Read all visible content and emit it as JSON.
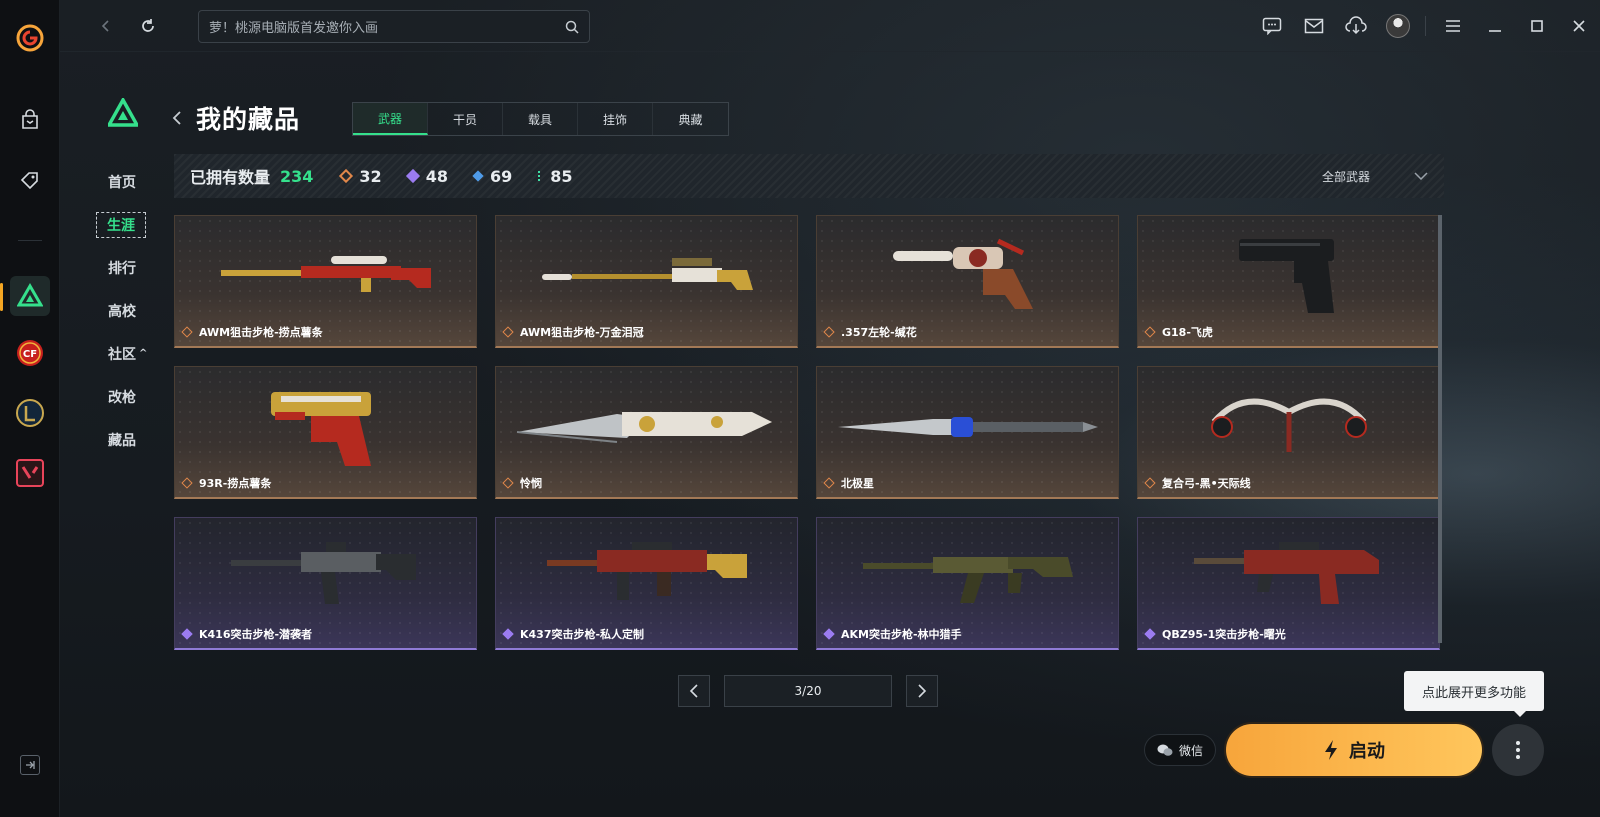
{
  "topbar": {
    "search_placeholder": "萝！桃源电脑版首发邀你入画"
  },
  "subnav": {
    "items": [
      {
        "label": "首页"
      },
      {
        "label": "生涯"
      },
      {
        "label": "排行"
      },
      {
        "label": "高校"
      },
      {
        "label": "社区"
      },
      {
        "label": "改枪"
      },
      {
        "label": "藏品"
      }
    ],
    "community_chevron": "^"
  },
  "page": {
    "title": "我的藏品",
    "tabs": [
      "武器",
      "干员",
      "载具",
      "挂饰",
      "典藏"
    ],
    "active_tab": "武器"
  },
  "stats": {
    "owned_label": "已拥有数量",
    "owned_value": "234",
    "tiers": [
      {
        "value": "32",
        "color": "#e0874a"
      },
      {
        "value": "48",
        "color": "#9b7cf0"
      },
      {
        "value": "69",
        "color": "#4f9be8"
      },
      {
        "value": "85",
        "color": "#3fe0a6"
      }
    ],
    "filter_label": "全部武器"
  },
  "items": [
    {
      "name": "AWM狙击步枪-捞点薯条",
      "rarity": "orange"
    },
    {
      "name": "AWM狙击步枪-万金泪冠",
      "rarity": "orange"
    },
    {
      "name": ".357左轮-缄花",
      "rarity": "orange"
    },
    {
      "name": "G18-飞虎",
      "rarity": "orange"
    },
    {
      "name": "93R-捞点薯条",
      "rarity": "orange"
    },
    {
      "name": "怜悯",
      "rarity": "orange"
    },
    {
      "name": "北极星",
      "rarity": "orange"
    },
    {
      "name": "复合弓-黑•天际线",
      "rarity": "orange"
    },
    {
      "name": "K416突击步枪-潜袭者",
      "rarity": "purple"
    },
    {
      "name": "K437突击步枪-私人定制",
      "rarity": "purple"
    },
    {
      "name": "AKM突击步枪-林中猎手",
      "rarity": "purple"
    },
    {
      "name": "QBZ95-1突击步枪-曙光",
      "rarity": "purple"
    }
  ],
  "pager": {
    "value": "3/20"
  },
  "actions": {
    "tooltip": "点此展开更多功能",
    "wechat_label": "微信",
    "launch_label": "启动"
  },
  "colors": {
    "accent_green": "#35e08c",
    "launch_orange": "#f7a53b",
    "tier_orange": "#e0874a",
    "tier_purple": "#9b7cf0"
  }
}
